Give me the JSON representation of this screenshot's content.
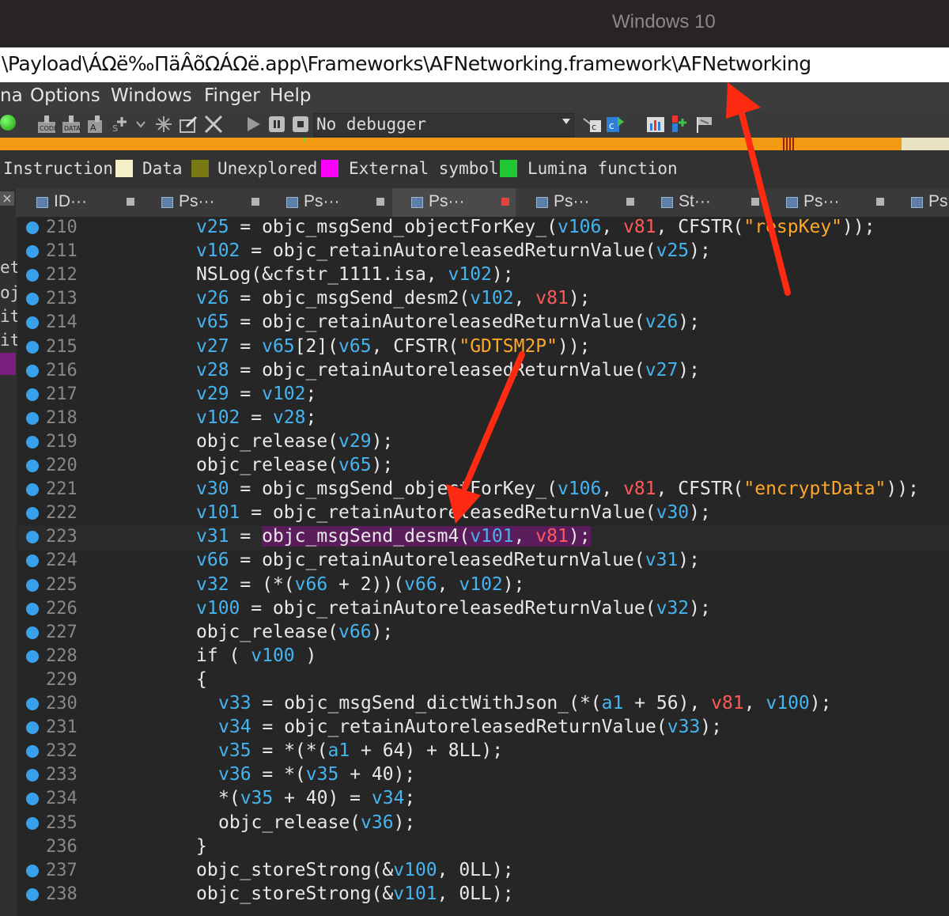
{
  "window": {
    "title": "Windows 10"
  },
  "path": "\\Payload\\ÁΩë‰ΠäÂõΩÁΩë.app\\Frameworks\\AFNetworking.framework\\AFNetworking",
  "menu": [
    "na",
    "Options",
    "Windows",
    "Finger",
    "Help"
  ],
  "toolbar": {
    "debugger": "No debugger"
  },
  "legend": {
    "items": [
      {
        "label": "Instruction",
        "color": "#f5f0c8"
      },
      {
        "label": "Data",
        "color": "#7a7a14"
      },
      {
        "label": "Unexplored",
        "color": "#ff00ff"
      },
      {
        "label": "External symbol",
        "color": "#22c832"
      },
      {
        "label": "Lumina function",
        "color": ""
      }
    ]
  },
  "tabs": [
    "ID···",
    "Ps···",
    "Ps···",
    "Ps···",
    "Ps···",
    "St···",
    "Ps···",
    "Ps"
  ],
  "left_stub": [
    "et",
    "oj",
    "it",
    "it"
  ],
  "code": [
    {
      "n": "210",
      "dot": true,
      "ind": 0,
      "t": "{v}v25{/} = objc_msgSend_objectForKey_({v}v106{/}, {r}v81{/}, CFSTR({s}\"respKey\"{/}));"
    },
    {
      "n": "211",
      "dot": true,
      "ind": 0,
      "t": "{v}v102{/} = objc_retainAutoreleasedReturnValue({v}v25{/});"
    },
    {
      "n": "212",
      "dot": true,
      "ind": 0,
      "t": "NSLog(&cfstr_1111.isa, {v}v102{/});"
    },
    {
      "n": "213",
      "dot": true,
      "ind": 0,
      "t": "{v}v26{/} = objc_msgSend_desm2({v}v102{/}, {r}v81{/});"
    },
    {
      "n": "214",
      "dot": true,
      "ind": 0,
      "t": "{v}v65{/} = objc_retainAutoreleasedReturnValue({v}v26{/});"
    },
    {
      "n": "215",
      "dot": true,
      "ind": 0,
      "t": "{v}v27{/} = {v}v65{/}[2]({v}v65{/}, CFSTR({s}\"GDTSM2P\"{/}));"
    },
    {
      "n": "216",
      "dot": true,
      "ind": 0,
      "t": "{v}v28{/} = objc_retainAutoreleasedReturnValue({v}v27{/});"
    },
    {
      "n": "217",
      "dot": true,
      "ind": 0,
      "t": "{v}v29{/} = {v}v102{/};"
    },
    {
      "n": "218",
      "dot": true,
      "ind": 0,
      "t": "{v}v102{/} = {v}v28{/};"
    },
    {
      "n": "219",
      "dot": true,
      "ind": 0,
      "t": "objc_release({v}v29{/});"
    },
    {
      "n": "220",
      "dot": true,
      "ind": 0,
      "t": "objc_release({v}v65{/});"
    },
    {
      "n": "221",
      "dot": true,
      "ind": 0,
      "t": "{v}v30{/} = objc_msgSend_objectForKey_({v}v106{/}, {r}v81{/}, CFSTR({s}\"encryptData\"{/}));"
    },
    {
      "n": "222",
      "dot": true,
      "ind": 0,
      "t": "{v}v101{/} = objc_retainAutoreleasedReturnValue({v}v30{/});"
    },
    {
      "n": "223",
      "dot": true,
      "ind": 0,
      "t": "{v}v31{/} = {h}objc_msgSend_desm4({v}v101{/}, {r}v81{/});{/h}"
    },
    {
      "n": "224",
      "dot": true,
      "ind": 0,
      "t": "{v}v66{/} = objc_retainAutoreleasedReturnValue({v}v31{/});"
    },
    {
      "n": "225",
      "dot": true,
      "ind": 0,
      "t": "{v}v32{/} = (*({v}v66{/} + 2))({v}v66{/}, {v}v102{/});"
    },
    {
      "n": "226",
      "dot": true,
      "ind": 0,
      "t": "{v}v100{/} = objc_retainAutoreleasedReturnValue({v}v32{/});"
    },
    {
      "n": "227",
      "dot": true,
      "ind": 0,
      "t": "objc_release({v}v66{/});"
    },
    {
      "n": "228",
      "dot": true,
      "ind": 0,
      "t": "if ( {v}v100{/} )"
    },
    {
      "n": "229",
      "dot": false,
      "ind": 0,
      "t": "{"
    },
    {
      "n": "230",
      "dot": true,
      "ind": 2,
      "t": "{v}v33{/} = objc_msgSend_dictWithJson_(*({v}a1{/} + 56), {r}v81{/}, {v}v100{/});"
    },
    {
      "n": "231",
      "dot": true,
      "ind": 2,
      "t": "{v}v34{/} = objc_retainAutoreleasedReturnValue({v}v33{/});"
    },
    {
      "n": "232",
      "dot": true,
      "ind": 2,
      "t": "{v}v35{/} = *(*({v}a1{/} + 64) + 8LL);"
    },
    {
      "n": "233",
      "dot": true,
      "ind": 2,
      "t": "{v}v36{/} = *({v}v35{/} + 40);"
    },
    {
      "n": "234",
      "dot": true,
      "ind": 2,
      "t": "*({v}v35{/} + 40) = {v}v34{/};"
    },
    {
      "n": "235",
      "dot": true,
      "ind": 2,
      "t": "objc_release({v}v36{/});"
    },
    {
      "n": "236",
      "dot": false,
      "ind": 0,
      "t": "}"
    },
    {
      "n": "237",
      "dot": true,
      "ind": 0,
      "t": "objc_storeStrong(&{v}v100{/}, 0LL);"
    },
    {
      "n": "238",
      "dot": true,
      "ind": 0,
      "t": "objc_storeStrong(&{v}v101{/}, 0LL);"
    }
  ],
  "current_line": "223",
  "colors": {
    "var": "#45b4f0",
    "arg": "#ff5a5a",
    "str": "#ffa726",
    "highlight": "#5b1c5b",
    "arrow": "#ff2a12"
  }
}
